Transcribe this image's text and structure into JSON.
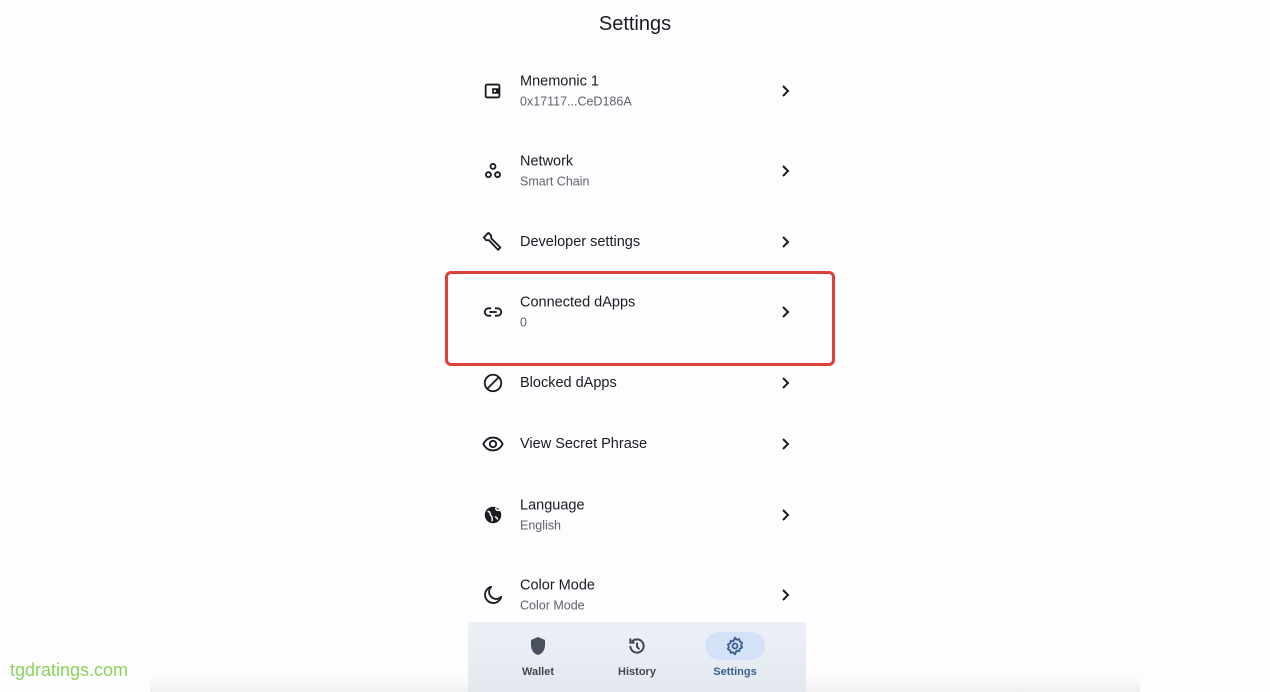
{
  "header": {
    "title": "Settings"
  },
  "settings": [
    {
      "label": "Mnemonic 1",
      "sub": "0x17117...CeD186A",
      "icon": "wallet-icon"
    },
    {
      "label": "Network",
      "sub": "Smart Chain",
      "icon": "network-icon"
    },
    {
      "label": "Developer settings",
      "icon": "wrench-icon"
    },
    {
      "label": "Connected dApps",
      "sub": "0",
      "icon": "link-icon"
    },
    {
      "label": "Blocked dApps",
      "icon": "block-icon"
    },
    {
      "label": "View Secret Phrase",
      "icon": "eye-icon"
    },
    {
      "label": "Language",
      "sub": "English",
      "icon": "globe-icon"
    },
    {
      "label": "Color Mode",
      "sub": "Color Mode",
      "icon": "moon-icon"
    }
  ],
  "nav": {
    "items": [
      {
        "label": "Wallet",
        "icon": "shield-icon"
      },
      {
        "label": "History",
        "icon": "history-icon"
      },
      {
        "label": "Settings",
        "icon": "gear-icon",
        "active": true
      }
    ]
  },
  "highlight_color": "#d9403a",
  "watermark": "tgdratings.com"
}
